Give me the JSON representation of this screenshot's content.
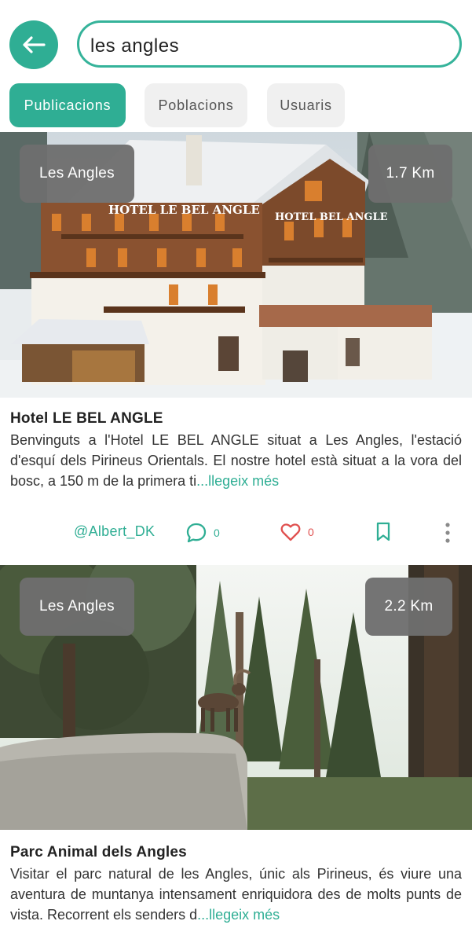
{
  "search": {
    "value": "les angles",
    "placeholder": ""
  },
  "tabs": [
    {
      "label": "Publicacions",
      "active": true
    },
    {
      "label": "Poblacions",
      "active": false
    },
    {
      "label": "Usuaris",
      "active": false
    }
  ],
  "posts": [
    {
      "location": "Les Angles",
      "distance": "1.7 Km",
      "title": "Hotel LE BEL ANGLE",
      "description": "Benvinguts a l'Hotel LE BEL ANGLE situat a Les Angles, l'estació d'esquí dels Pirineus Orientals. El nostre hotel està situat a la vora del bosc, a 150 m de la primera ti",
      "more_label": "...llegeix més",
      "sign_main": "HOTEL LE BEL ANGLE",
      "sign_side": "HOTEL BEL ANGLE",
      "author": "@Albert_DK",
      "comments": "0",
      "likes": "0"
    },
    {
      "location": "Les Angles",
      "distance": "2.2 Km",
      "title": "Parc Animal dels Angles",
      "description": "Visitar el parc natural de les Angles, únic als Pirineus, és viure una aventura de muntanya intensament enriquidora des de molts punts de vista. Recorrent els senders d",
      "more_label": "...llegeix més"
    }
  ],
  "colors": {
    "accent": "#2fae94",
    "like": "#e0504f",
    "chip_inactive": "#f0f0f0",
    "tag_bg": "#6e6e6e"
  },
  "icons": {
    "back": "arrow-left-icon",
    "comment": "comment-bubble-icon",
    "like": "heart-icon",
    "save": "bookmark-icon",
    "more": "more-vertical-icon"
  }
}
